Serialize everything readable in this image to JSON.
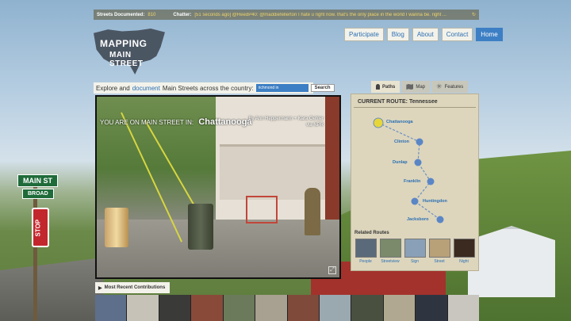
{
  "ticker": {
    "documented_label": "Streets Documented:",
    "documented_count": "810",
    "chatter_label": "Chatter:",
    "chatter_msg": "[51 seconds ago] @ReedP40: @maddiefellerton I hate u right now. that's the only place in the world I wanna be. right ..."
  },
  "logo": {
    "line1": "MAPPING",
    "line2": "MAIN STREET"
  },
  "nav": [
    "Participate",
    "Blog",
    "About",
    "Contact",
    "Home"
  ],
  "explore": {
    "prefix": "Explore and",
    "link": "document",
    "suffix": "Main Streets across the country:",
    "search_value": "richmond in",
    "search_btn": "Search"
  },
  "photo": {
    "on_main": "YOU ARE ON MAIN STREET IN:",
    "city": "Chattanooga",
    "credit_line1": "By Ann Heppermann + Kara Oehler",
    "credit_line2": "via NPR"
  },
  "tabs": [
    {
      "label": "Paths",
      "icon": "footprint-icon"
    },
    {
      "label": "Map",
      "icon": "map-icon"
    },
    {
      "label": "Features",
      "icon": "star-icon"
    }
  ],
  "route": {
    "title": "CURRENT ROUTE: Tennessee",
    "stops": [
      "Chattanooga",
      "Clinton",
      "Dunlap",
      "Franklin",
      "Huntingdon",
      "Jacksboro"
    ],
    "related_label": "Related Routes",
    "related": [
      {
        "label": "People",
        "color": "#5a6a7a"
      },
      {
        "label": "Streetview",
        "color": "#7a8a6a"
      },
      {
        "label": "Sign",
        "color": "#8aa0b8"
      },
      {
        "label": "Street",
        "color": "#b8a078"
      },
      {
        "label": "Night",
        "color": "#3a2a20"
      }
    ]
  },
  "contrib": {
    "label": "Most Recent Contributions",
    "thumbs": [
      "#5d6f8a",
      "#c7c2b8",
      "#3a3a38",
      "#8a4a3a",
      "#6a7a5a",
      "#a8a090",
      "#7f4a3a",
      "#9aa8b0",
      "#4a5040",
      "#b0a890",
      "#2f3540",
      "#c9c6c0"
    ]
  },
  "colors": {
    "accent": "#3d7fc4",
    "route_stop": "#5b86c6",
    "start_stop": "#e6d63a"
  }
}
